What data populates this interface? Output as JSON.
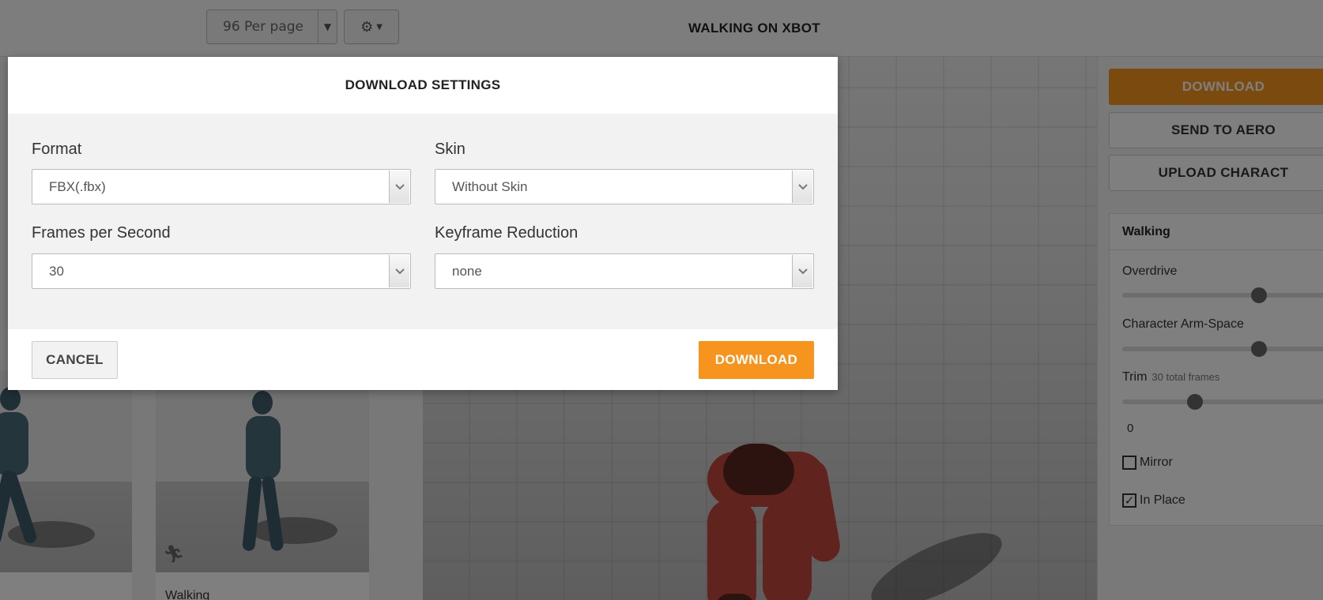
{
  "toolbar": {
    "per_page": "96 Per page",
    "gear_icon": "gear-icon"
  },
  "viewer": {
    "title": "WALKING ON XBOT"
  },
  "cards": [
    {
      "name": ""
    },
    {
      "name": "Walking"
    }
  ],
  "right_panel": {
    "download_label": "DOWNLOAD",
    "send_label": "SEND TO AERO",
    "upload_label": "UPLOAD CHARACT",
    "animation_name": "Walking",
    "overdrive_label": "Overdrive",
    "overdrive_value": 0.64,
    "arm_space_label": "Character Arm-Space",
    "arm_space_value": 0.64,
    "trim_label": "Trim",
    "trim_sub": "30 total frames",
    "trim_value": 0.34,
    "trim_start": "0",
    "mirror_label": "Mirror",
    "mirror_checked": false,
    "in_place_label": "In Place",
    "in_place_checked": true
  },
  "modal": {
    "title": "DOWNLOAD SETTINGS",
    "format_label": "Format",
    "format_value": "FBX(.fbx)",
    "skin_label": "Skin",
    "skin_value": "Without Skin",
    "fps_label": "Frames per Second",
    "fps_value": "30",
    "keyframe_label": "Keyframe Reduction",
    "keyframe_value": "none",
    "cancel_label": "CANCEL",
    "download_label": "DOWNLOAD"
  },
  "colors": {
    "accent": "#f7941d",
    "overlay": "rgba(0,0,0,0.5)"
  }
}
